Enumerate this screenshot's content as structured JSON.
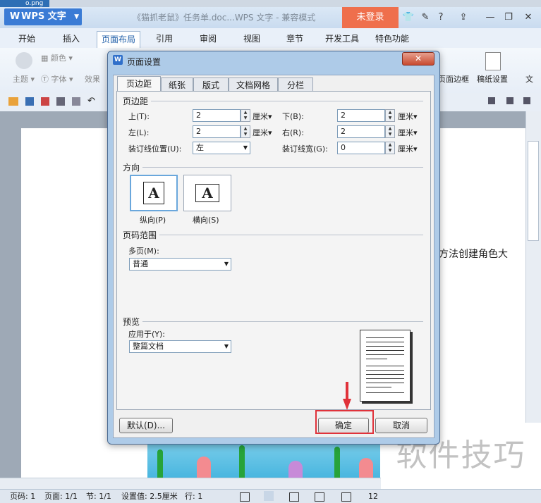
{
  "topfile": "o.png",
  "app": {
    "name": "WPS 文字",
    "doc_title": "《猫抓老鼠》任务单.doc...WPS 文字 - 兼容模式",
    "login": "未登录",
    "help": "?"
  },
  "tabs": [
    "开始",
    "插入",
    "页面布局",
    "引用",
    "审阅",
    "视图",
    "章节",
    "开发工具",
    "特色功能"
  ],
  "ribbon": {
    "color": "颜色",
    "theme": "主题",
    "font": "字体",
    "effect": "效果",
    "page_border": "页面边框",
    "paper_settings": "稿纸设置",
    "wen": "文"
  },
  "document": {
    "visible_text": "方法创建角色大"
  },
  "watermark": "软件技巧",
  "dialog": {
    "title": "页面设置",
    "tabs": [
      "页边距",
      "纸张",
      "版式",
      "文档网格",
      "分栏"
    ],
    "margins": {
      "section": "页边距",
      "top_label": "上(T):",
      "top_value": "2",
      "bottom_label": "下(B):",
      "bottom_value": "2",
      "left_label": "左(L):",
      "left_value": "2",
      "right_label": "右(R):",
      "right_value": "2",
      "gutter_pos_label": "装订线位置(U):",
      "gutter_pos_value": "左",
      "gutter_width_label": "装订线宽(G):",
      "gutter_width_value": "0",
      "unit": "厘米"
    },
    "orientation": {
      "section": "方向",
      "portrait": "纵向(P)",
      "landscape": "横向(S)",
      "glyph": "A"
    },
    "page_range": {
      "section": "页码范围",
      "multi_label": "多页(M):",
      "multi_value": "普通"
    },
    "preview": {
      "section": "预览",
      "apply_label": "应用于(Y):",
      "apply_value": "整篇文档"
    },
    "buttons": {
      "default": "默认(D)...",
      "ok": "确定",
      "cancel": "取消"
    }
  },
  "statusbar": {
    "page_code": "页码: 1",
    "page": "页面: 1/1",
    "section": "节: 1/1",
    "setting": "设置值: 2.5厘米",
    "row": "行: 1",
    "zoom": "12"
  }
}
